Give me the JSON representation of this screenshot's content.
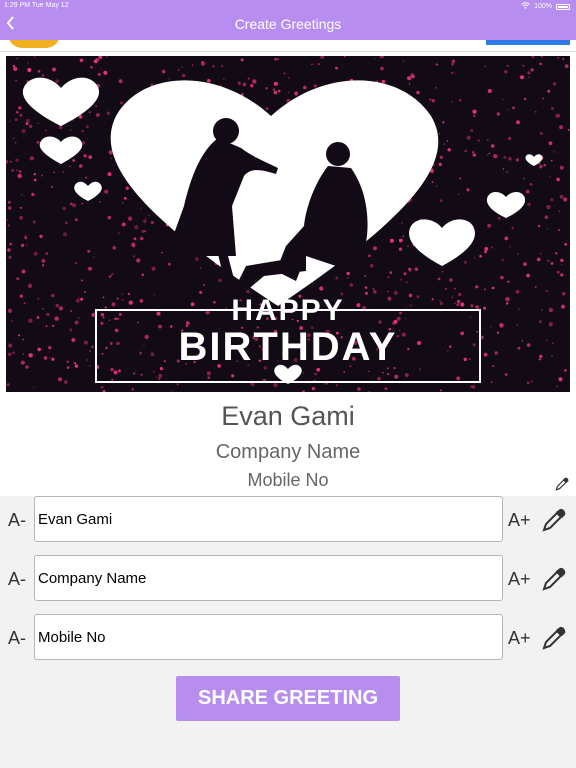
{
  "status_bar": {
    "time": "1:29 PM   Tue May 12",
    "battery": "100%"
  },
  "header": {
    "title": "Create Greetings",
    "back_icon": "chevron-left-icon"
  },
  "card": {
    "greeting_line1": "HAPPY",
    "greeting_line2": "BIRTHDAY",
    "name": "Evan Gami",
    "company": "Company Name",
    "mobile": "Mobile No"
  },
  "controls": {
    "decrease_label": "A-",
    "increase_label": "A+",
    "fields": [
      {
        "value": "Evan Gami"
      },
      {
        "value": "Company Name"
      },
      {
        "value": "Mobile No"
      }
    ]
  },
  "share_button": {
    "label": "SHARE GREETING"
  },
  "colors": {
    "accent": "#b78ef0",
    "card_background": "#120a14",
    "sparkle": "#e8347a"
  }
}
